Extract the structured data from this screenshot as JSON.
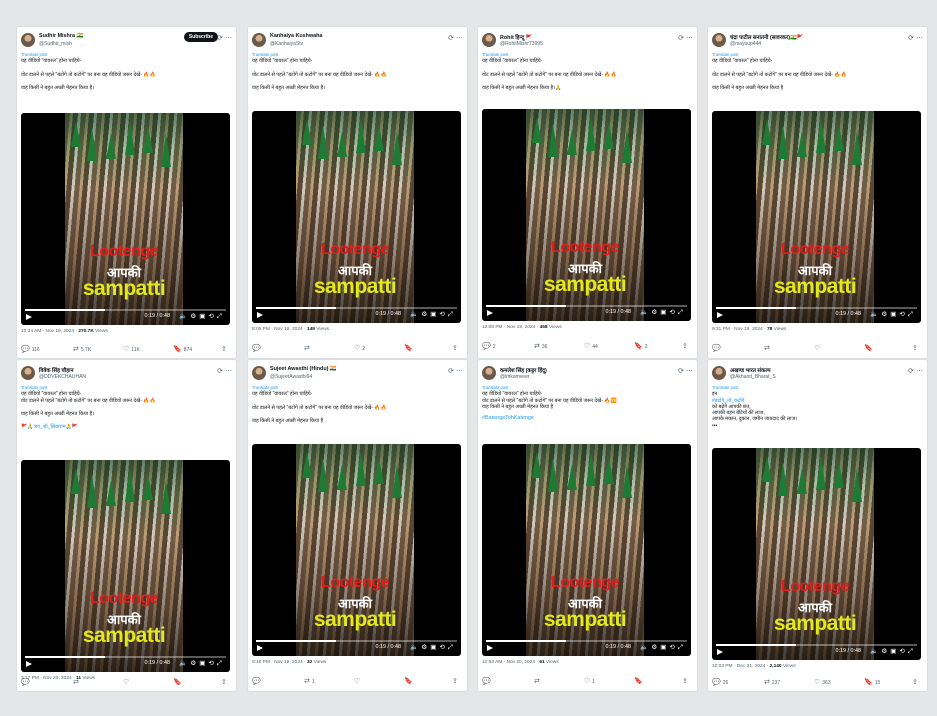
{
  "shared": {
    "translate": "Translate post",
    "overlay_line1": "Lootenge",
    "overlay_line2": "आपकी",
    "overlay_line3": "sampatti",
    "video_time": "0:19 / 0:48",
    "subscribe": "Subscribe"
  },
  "posts": [
    {
      "name": "Sudhir Mishra 🇮🇳",
      "handle": "@Sudhir_mish",
      "lines": [
        "यह वीडियो \"वायरल\" होना चाहिये-",
        "",
        "वोट डालने से पहले \"बटोगे तो कटोगे\" पर बना यह वीडियो जरूर देखें- 🔥🔥",
        "",
        "वाह किसी ने बहुत अच्छी मेहनत किया है।"
      ],
      "time": "10:34 AM · Nov 19, 2024 · ",
      "views": "270.7K",
      "views_label": " Views",
      "replies": "116",
      "reposts": "5.7K",
      "likes": "11K",
      "bookmarks": "874"
    },
    {
      "name": "Kanhaiya Kushwaha",
      "handle": "@KanhaiyaStv",
      "lines": [
        "यह वीडियो \"वायरल\" होना चाहिये-",
        "",
        "वोट डालने से पहले \"बटोगे तो कटोगे\" पर बना यह वीडियो जरूर देखें- 🔥🔥",
        "",
        "वाह किसी ने बहुत अच्छी मेहनत किया है।"
      ],
      "time": "8:05 PM · Nov 19, 2024 · ",
      "views": "149",
      "views_label": " Views",
      "replies": "",
      "reposts": "",
      "likes": "2",
      "bookmarks": ""
    },
    {
      "name": "Rohit हिन्दू 🚩",
      "handle": "@RohitMishr73995",
      "lines": [
        "यह वीडियो \"वायरल\" होना चाहिये-",
        "",
        "वोट डालने से पहले \"बटोगे तो कटोगे\" पर बना यह वीडियो जरूर देखें- 🔥🔥",
        "",
        "वाह किसी ने बहुत अच्छी मेहनत किया है।🙏"
      ],
      "time": "12:08 PM · Nov 19, 2024 · ",
      "views": "458",
      "views_label": " Views",
      "replies": "2",
      "reposts": "36",
      "likes": "44",
      "bookmarks": "2"
    },
    {
      "name": "चंद्रा पाटील सनातनी (सावरकर)🇮🇳🚩",
      "handle": "@mayuup444",
      "lines": [
        "यह वीडियो \"वायरल\" होना चाहिये-",
        "",
        "वोट डालने से पहले \"बटोगे तो कटोगे\" पर बना यह वीडियो जरूर देखें- 🔥🔥",
        "",
        "वाह किसी ने बहुत अच्छी मेहनत किया है"
      ],
      "time": "9:31 PM · Nov 19, 2024 · ",
      "views": "78",
      "views_label": " Views",
      "replies": "",
      "reposts": "",
      "likes": "",
      "bookmarks": ""
    },
    {
      "name": "विवेक सिंह चौहान",
      "handle": "@DDVEKCHAUHAN",
      "lines": [
        "यह वीडियो \"वायरल\" होना चाहिये-",
        "वोट डालने से पहले \"बटोगे तो कटोगे\" पर बना यह वीडियो जरूर देखें- 🔥🔥",
        "",
        "वाह किसी ने बहुत अच्छी मेहनत किया है।",
        "",
        "🚩🙏जय_श्री_सियाराम🙏🚩"
      ],
      "time": "3:17 PM · Nov 20, 2024 · ",
      "views": "11",
      "views_label": " Views",
      "replies": "",
      "reposts": "",
      "likes": "",
      "bookmarks": ""
    },
    {
      "name": "Sujeet Awasthi (Hindu) 🇮🇳",
      "handle": "@SujeetAwasthi94",
      "lines": [
        "यह वीडियो \"वायरल\" होना चाहिये-",
        "",
        "वोट डालने से पहले \"बटोगे तो कटोगे\" पर बना यह वीडियो जरूर देखें- 🔥🔥",
        "",
        "वाह किसी ने बहुत अच्छी मेहनत किया है"
      ],
      "time": "9:18 PM · Nov 19, 2024 · ",
      "views": "32",
      "views_label": " Views",
      "replies": "",
      "reposts": "1",
      "likes": "",
      "bookmarks": ""
    },
    {
      "name": "कमलेश सिंह (कट्टर हिंदू)",
      "handle": "@imkamveer",
      "lines": [
        "यह वीडियो \"वायरल\" होना चाहिये-",
        "वोट डालने से पहले \"बटोगे तो कटोगे\" पर बना यह वीडियो जरूर देखें- 🔥🆚",
        "वाह किसी ने बहुत अच्छी मेहनत किया है"
      ],
      "tag": "#BatengeTohKatenge",
      "time": "12:53 AM · Nov 20, 2024 · ",
      "views": "61",
      "views_label": " Views",
      "replies": "",
      "reposts": "",
      "likes": "1",
      "bookmarks": ""
    },
    {
      "name": "अखण्ड भारत संकल्प",
      "handle": "@Akhand_Bharat_S",
      "lines": [
        "इन",
        "#बटोगे_तो_कटोगे",
        "को बढ़ेंगे आपकी छत,",
        "आपकी बहन बेटियों की लाज,",
        "आपके मकान, दुकान, जमीन जायदाद की लाज।",
        "•••"
      ],
      "time": "10:03 PM · Dec 31, 2024 · ",
      "views": "2,140",
      "views_label": " Views",
      "replies": "26",
      "reposts": "237",
      "likes": "363",
      "bookmarks": "15"
    }
  ]
}
